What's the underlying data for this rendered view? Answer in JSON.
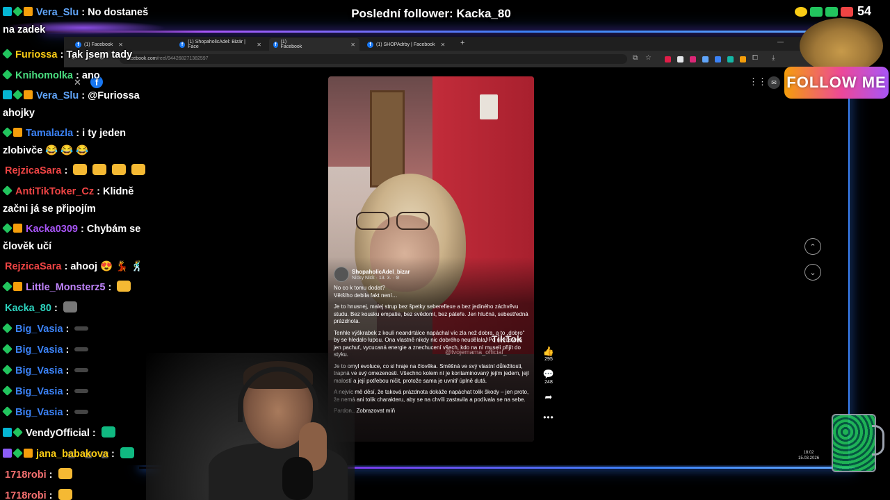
{
  "overlay": {
    "last_follower": "Poslední follower: Kacka_80",
    "viewer_count": "54",
    "follow_me": "FOLLOW ME"
  },
  "browser": {
    "tabs": [
      {
        "label": "(1) Facebook"
      },
      {
        "label": "(1) ShopaholicAdel: Bizár | Face"
      },
      {
        "label": "(1) Facebook"
      },
      {
        "label": "(1) SHOPAdrby | Facebook"
      }
    ],
    "url_host": "facebook.com",
    "url_path": "/reel/944268271382597"
  },
  "reel": {
    "author": "ShopaholicAdel_bizar",
    "meta": "Nicky Nick · 13. 3. · ⚙",
    "watermark": "♪ TikTok",
    "watermark_handle": "@tvojemama_official_",
    "caption": [
      "No co k tomu dodat?\nVětšího debila fakt není…",
      "Je to hnusnej, malej strup bez špetky sebereflexe a bez jediného záchvěvu studu. Bez kousku empatie, bez svědomí, bez páteře. Jen hlučná, sebestředná prázdnota.",
      "Tenhle výškrabek z koulí neandrtálce napáchal víc zla než dobra, a to „dobro“ by se hledalo lupou. Ona vlastně nikdy nic dobrého neudělala. Po ní zůstává jen pachuť, vycucaná energie a znechucení všech, kdo na ní museli přijít do styku.",
      "Je to omyl evoluce, co si hraje na člověka. Směšná ve svý vlastní důležitosti, trapná ve svý omezenosti. Všechno kolem ní je kontaminovaný jejím jedem, její malostí a její potřebou ničit, protože sama je uvnitř úplně dutá.",
      "A nejvíc mě děsí, že taková prázdnota dokáže napáchat tolik škody – jen proto, že nemá ani tolik charakteru, aby se na chvíli zastavila a podívala se na sebe."
    ],
    "see_more": "Pardon.. Zobrazovat míň",
    "likes": "295",
    "comments": "248"
  },
  "taskbar": {
    "time": "18:02",
    "date": "15.03.2026"
  },
  "chat": [
    {
      "badges": [
        "b-prime",
        "b-green",
        "b-gold"
      ],
      "user": "Vera_Slu",
      "color": "#60a5fa",
      "text": "No dostaneš",
      "cont": "na zadek",
      "emotes": []
    },
    {
      "badges": [
        "b-green"
      ],
      "user": "Furiossa",
      "color": "#facc15",
      "text": "Tak jsem tady",
      "cont": "",
      "emotes": []
    },
    {
      "badges": [
        "b-green"
      ],
      "user": "Knihomolka",
      "color": "#4ade80",
      "text": "ano",
      "cont": "",
      "emotes": []
    },
    {
      "badges": [
        "b-prime",
        "b-green",
        "b-gold"
      ],
      "user": "Vera_Slu",
      "color": "#60a5fa",
      "text": "@Furiossa",
      "cont": "ahojky",
      "emotes": []
    },
    {
      "badges": [
        "b-green",
        "b-gold"
      ],
      "user": "Tamalazla",
      "color": "#3b82f6",
      "text": "i ty jeden",
      "cont": "zlobivče 😂 😂 😂",
      "emotes": []
    },
    {
      "badges": [],
      "user": "RejzicaSara",
      "color": "#ef4444",
      "text": "",
      "cont": "",
      "emotes": [
        "e-cat",
        "e-cat",
        "e-cat",
        "e-cat"
      ]
    },
    {
      "badges": [
        "b-green"
      ],
      "user": "AntiTikToker_Cz",
      "color": "#ef4444",
      "text": "Klidně",
      "cont": "začni já se připojím",
      "emotes": []
    },
    {
      "badges": [
        "b-green",
        "b-gold"
      ],
      "user": "Kacka0309",
      "color": "#a855f7",
      "text": "Chybám se",
      "cont": "člověk učí",
      "emotes": []
    },
    {
      "badges": [],
      "user": "RejzicaSara",
      "color": "#ef4444",
      "text": "ahooj 😍 💃 🕺",
      "cont": "",
      "emotes": []
    },
    {
      "badges": [
        "b-green",
        "b-gold"
      ],
      "user": "Little_Monsterz5",
      "color": "#c084fc",
      "text": "",
      "cont": "",
      "emotes": [
        "e-cat"
      ]
    },
    {
      "badges": [],
      "user": "Kacka_80",
      "color": "#2dd4bf",
      "text": "",
      "cont": "",
      "emotes": [
        "e-grey"
      ]
    },
    {
      "badges": [
        "b-green"
      ],
      "user": "Big_Vasia",
      "color": "#3b82f6",
      "text": "",
      "cont": "",
      "emotes": [
        "e-dot"
      ]
    },
    {
      "badges": [
        "b-green"
      ],
      "user": "Big_Vasia",
      "color": "#3b82f6",
      "text": "",
      "cont": "",
      "emotes": [
        "e-dot"
      ]
    },
    {
      "badges": [
        "b-green"
      ],
      "user": "Big_Vasia",
      "color": "#3b82f6",
      "text": "",
      "cont": "",
      "emotes": [
        "e-dot"
      ]
    },
    {
      "badges": [
        "b-green"
      ],
      "user": "Big_Vasia",
      "color": "#3b82f6",
      "text": "",
      "cont": "",
      "emotes": [
        "e-dot"
      ]
    },
    {
      "badges": [
        "b-green"
      ],
      "user": "Big_Vasia",
      "color": "#3b82f6",
      "text": "",
      "cont": "",
      "emotes": [
        "e-dot"
      ]
    },
    {
      "badges": [
        "b-prime",
        "b-green"
      ],
      "user": "VendyOfficial",
      "color": "#ffffff",
      "text": "",
      "cont": "",
      "emotes": [
        "e-cubes"
      ]
    },
    {
      "badges": [
        "b-purple",
        "b-green",
        "b-gold"
      ],
      "user": "jana_babakova",
      "color": "#facc15",
      "text": "",
      "cont": "",
      "emotes": [
        "e-cubes"
      ]
    },
    {
      "badges": [],
      "user": "1718robi",
      "color": "#f87171",
      "text": "",
      "cont": "",
      "emotes": [
        "e-cat"
      ]
    },
    {
      "badges": [],
      "user": "1718robi",
      "color": "#f87171",
      "text": "",
      "cont": "",
      "emotes": [
        "e-cat"
      ]
    }
  ]
}
